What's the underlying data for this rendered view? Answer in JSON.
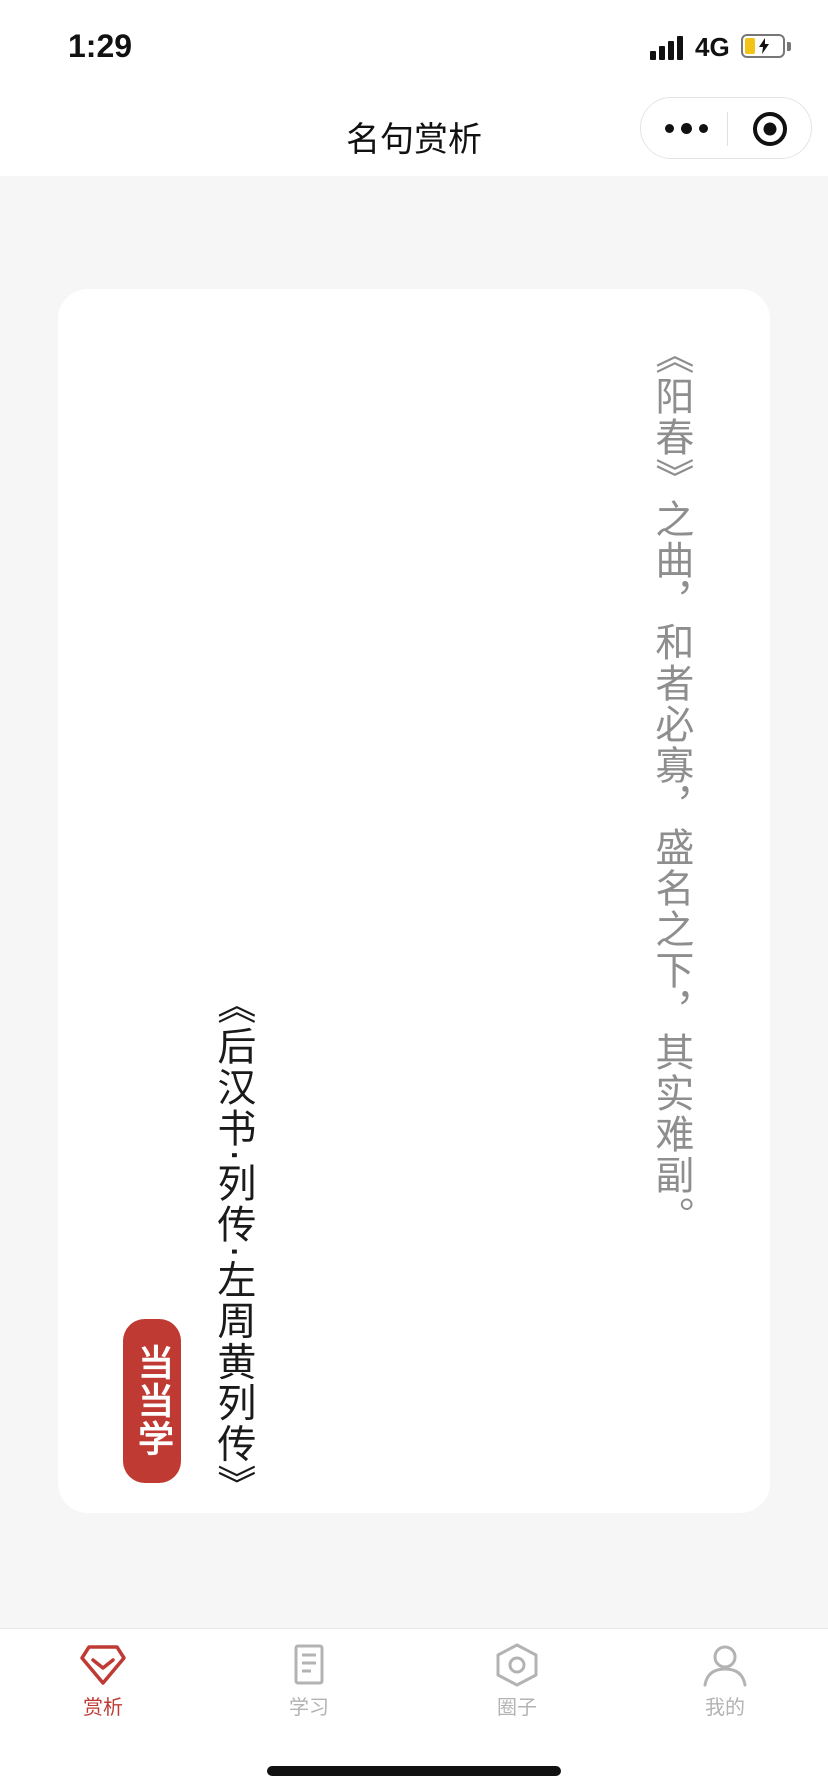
{
  "status_bar": {
    "time": "1:29",
    "network": "4G",
    "battery_level": 0.25,
    "battery_color": "#f3c318"
  },
  "nav_bar": {
    "title": "名句赏析",
    "more_icon": "more-dots-icon",
    "close_icon": "target-close-icon"
  },
  "card": {
    "quote": "《阳春》之曲，和者必寡，盛名之下，其实难副。",
    "source": "《后汉书·列传·左周黄列传》",
    "seal": "当当学"
  },
  "tabs": [
    {
      "label": "赏析",
      "icon": "diamond-icon",
      "active": true
    },
    {
      "label": "学习",
      "icon": "document-icon",
      "active": false
    },
    {
      "label": "圈子",
      "icon": "hexagon-icon",
      "active": false
    },
    {
      "label": "我的",
      "icon": "person-icon",
      "active": false
    }
  ],
  "colors": {
    "accent": "#c03a34",
    "quote_text": "#8e8e8e",
    "inactive_tab": "#b3b3b3",
    "background": "#f6f6f6"
  }
}
